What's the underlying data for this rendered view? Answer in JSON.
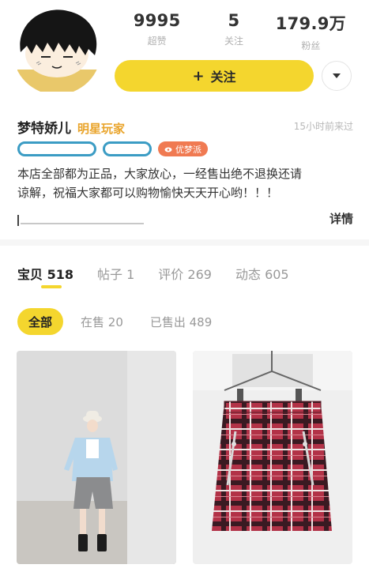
{
  "stats": [
    {
      "value": "9995",
      "label": "超赞"
    },
    {
      "value": "5",
      "label": "关注"
    },
    {
      "value": "179.9万",
      "label": "粉丝"
    }
  ],
  "follow_button": {
    "plus": "+",
    "label": "关注"
  },
  "more_button": {
    "icon": "caret-down-icon"
  },
  "profile": {
    "name": "梦特娇儿",
    "level": "明星玩家",
    "last_active": "15小时前来过",
    "badge_label": "优梦派",
    "description_line1": "本店全部都为正品，大家放心，一经售出绝不退换还请",
    "description_line2": "谅解，祝福大家都可以购物愉快天天开心哟！！！",
    "details_label": "详情"
  },
  "tabs": [
    {
      "label": "宝贝",
      "count": "518",
      "active": true
    },
    {
      "label": "帖子",
      "count": "1",
      "active": false
    },
    {
      "label": "评价",
      "count": "269",
      "active": false
    },
    {
      "label": "动态",
      "count": "605",
      "active": false
    }
  ],
  "filters": [
    {
      "label": "全部",
      "active": true
    },
    {
      "label": "在售 20",
      "active": false
    },
    {
      "label": "已售出 489",
      "active": false
    }
  ],
  "colors": {
    "accent_yellow": "#f4d62e",
    "level_orange": "#e9a42b",
    "badge_orange": "#f07a52",
    "tag_blue": "#3b9cc4"
  }
}
